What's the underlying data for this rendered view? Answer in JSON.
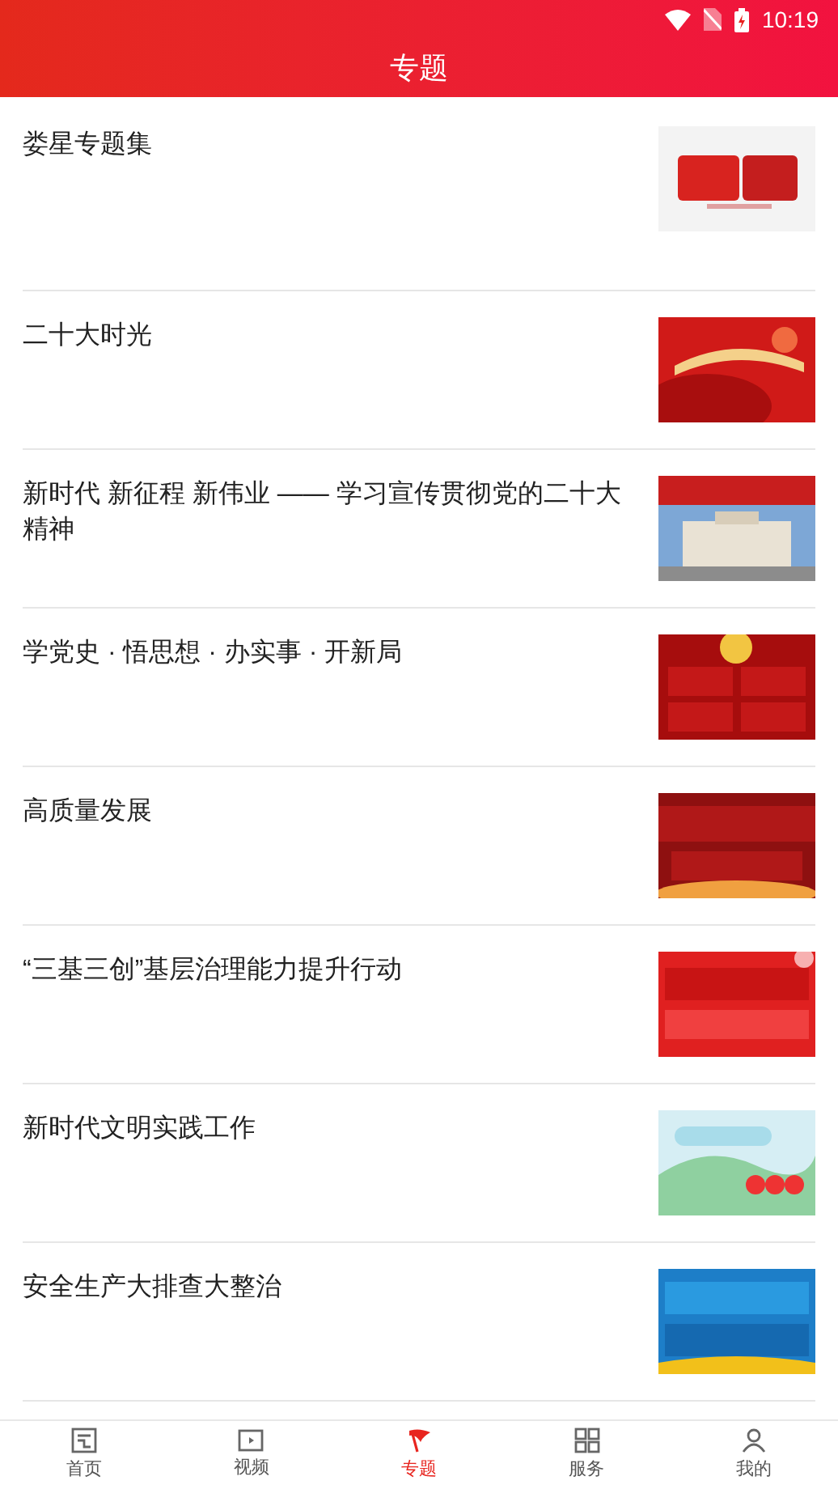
{
  "status_bar": {
    "time": "10:19"
  },
  "header": {
    "title": "专题"
  },
  "topics": [
    {
      "title": "娄星专题集"
    },
    {
      "title": "二十大时光"
    },
    {
      "title": "新时代 新征程 新伟业 —— 学习宣传贯彻党的二十大精神"
    },
    {
      "title": "学党史 · 悟思想 · 办实事 · 开新局"
    },
    {
      "title": "高质量发展"
    },
    {
      "title": "“三基三创”基层治理能力提升行动"
    },
    {
      "title": "新时代文明实践工作"
    },
    {
      "title": "安全生产大排查大整治"
    }
  ],
  "bottom_nav": [
    {
      "label": "首页",
      "selected": false
    },
    {
      "label": "视频",
      "selected": false
    },
    {
      "label": "专题",
      "selected": true
    },
    {
      "label": "服务",
      "selected": false
    },
    {
      "label": "我的",
      "selected": false
    }
  ]
}
